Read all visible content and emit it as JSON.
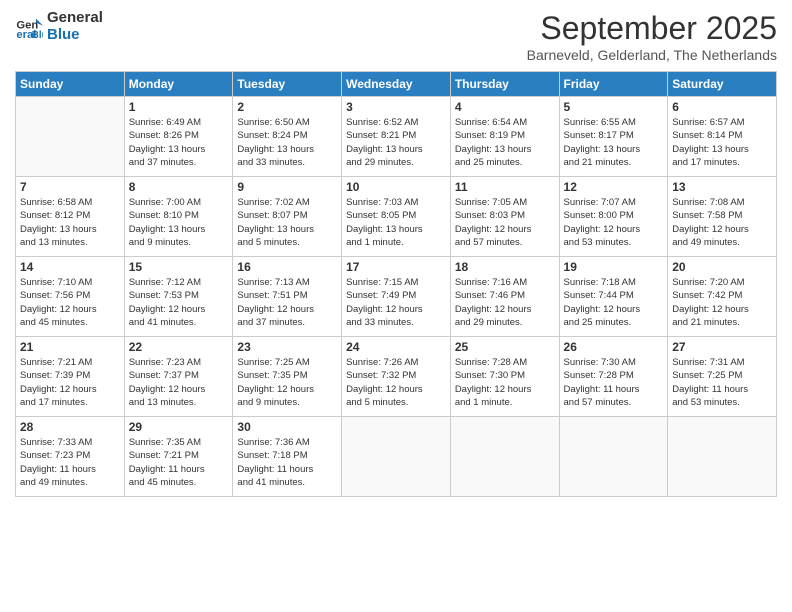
{
  "header": {
    "logo_line1": "General",
    "logo_line2": "Blue",
    "month": "September 2025",
    "location": "Barneveld, Gelderland, The Netherlands"
  },
  "days_of_week": [
    "Sunday",
    "Monday",
    "Tuesday",
    "Wednesday",
    "Thursday",
    "Friday",
    "Saturday"
  ],
  "weeks": [
    [
      {
        "day": "",
        "info": ""
      },
      {
        "day": "1",
        "info": "Sunrise: 6:49 AM\nSunset: 8:26 PM\nDaylight: 13 hours\nand 37 minutes."
      },
      {
        "day": "2",
        "info": "Sunrise: 6:50 AM\nSunset: 8:24 PM\nDaylight: 13 hours\nand 33 minutes."
      },
      {
        "day": "3",
        "info": "Sunrise: 6:52 AM\nSunset: 8:21 PM\nDaylight: 13 hours\nand 29 minutes."
      },
      {
        "day": "4",
        "info": "Sunrise: 6:54 AM\nSunset: 8:19 PM\nDaylight: 13 hours\nand 25 minutes."
      },
      {
        "day": "5",
        "info": "Sunrise: 6:55 AM\nSunset: 8:17 PM\nDaylight: 13 hours\nand 21 minutes."
      },
      {
        "day": "6",
        "info": "Sunrise: 6:57 AM\nSunset: 8:14 PM\nDaylight: 13 hours\nand 17 minutes."
      }
    ],
    [
      {
        "day": "7",
        "info": "Sunrise: 6:58 AM\nSunset: 8:12 PM\nDaylight: 13 hours\nand 13 minutes."
      },
      {
        "day": "8",
        "info": "Sunrise: 7:00 AM\nSunset: 8:10 PM\nDaylight: 13 hours\nand 9 minutes."
      },
      {
        "day": "9",
        "info": "Sunrise: 7:02 AM\nSunset: 8:07 PM\nDaylight: 13 hours\nand 5 minutes."
      },
      {
        "day": "10",
        "info": "Sunrise: 7:03 AM\nSunset: 8:05 PM\nDaylight: 13 hours\nand 1 minute."
      },
      {
        "day": "11",
        "info": "Sunrise: 7:05 AM\nSunset: 8:03 PM\nDaylight: 12 hours\nand 57 minutes."
      },
      {
        "day": "12",
        "info": "Sunrise: 7:07 AM\nSunset: 8:00 PM\nDaylight: 12 hours\nand 53 minutes."
      },
      {
        "day": "13",
        "info": "Sunrise: 7:08 AM\nSunset: 7:58 PM\nDaylight: 12 hours\nand 49 minutes."
      }
    ],
    [
      {
        "day": "14",
        "info": "Sunrise: 7:10 AM\nSunset: 7:56 PM\nDaylight: 12 hours\nand 45 minutes."
      },
      {
        "day": "15",
        "info": "Sunrise: 7:12 AM\nSunset: 7:53 PM\nDaylight: 12 hours\nand 41 minutes."
      },
      {
        "day": "16",
        "info": "Sunrise: 7:13 AM\nSunset: 7:51 PM\nDaylight: 12 hours\nand 37 minutes."
      },
      {
        "day": "17",
        "info": "Sunrise: 7:15 AM\nSunset: 7:49 PM\nDaylight: 12 hours\nand 33 minutes."
      },
      {
        "day": "18",
        "info": "Sunrise: 7:16 AM\nSunset: 7:46 PM\nDaylight: 12 hours\nand 29 minutes."
      },
      {
        "day": "19",
        "info": "Sunrise: 7:18 AM\nSunset: 7:44 PM\nDaylight: 12 hours\nand 25 minutes."
      },
      {
        "day": "20",
        "info": "Sunrise: 7:20 AM\nSunset: 7:42 PM\nDaylight: 12 hours\nand 21 minutes."
      }
    ],
    [
      {
        "day": "21",
        "info": "Sunrise: 7:21 AM\nSunset: 7:39 PM\nDaylight: 12 hours\nand 17 minutes."
      },
      {
        "day": "22",
        "info": "Sunrise: 7:23 AM\nSunset: 7:37 PM\nDaylight: 12 hours\nand 13 minutes."
      },
      {
        "day": "23",
        "info": "Sunrise: 7:25 AM\nSunset: 7:35 PM\nDaylight: 12 hours\nand 9 minutes."
      },
      {
        "day": "24",
        "info": "Sunrise: 7:26 AM\nSunset: 7:32 PM\nDaylight: 12 hours\nand 5 minutes."
      },
      {
        "day": "25",
        "info": "Sunrise: 7:28 AM\nSunset: 7:30 PM\nDaylight: 12 hours\nand 1 minute."
      },
      {
        "day": "26",
        "info": "Sunrise: 7:30 AM\nSunset: 7:28 PM\nDaylight: 11 hours\nand 57 minutes."
      },
      {
        "day": "27",
        "info": "Sunrise: 7:31 AM\nSunset: 7:25 PM\nDaylight: 11 hours\nand 53 minutes."
      }
    ],
    [
      {
        "day": "28",
        "info": "Sunrise: 7:33 AM\nSunset: 7:23 PM\nDaylight: 11 hours\nand 49 minutes."
      },
      {
        "day": "29",
        "info": "Sunrise: 7:35 AM\nSunset: 7:21 PM\nDaylight: 11 hours\nand 45 minutes."
      },
      {
        "day": "30",
        "info": "Sunrise: 7:36 AM\nSunset: 7:18 PM\nDaylight: 11 hours\nand 41 minutes."
      },
      {
        "day": "",
        "info": ""
      },
      {
        "day": "",
        "info": ""
      },
      {
        "day": "",
        "info": ""
      },
      {
        "day": "",
        "info": ""
      }
    ]
  ]
}
